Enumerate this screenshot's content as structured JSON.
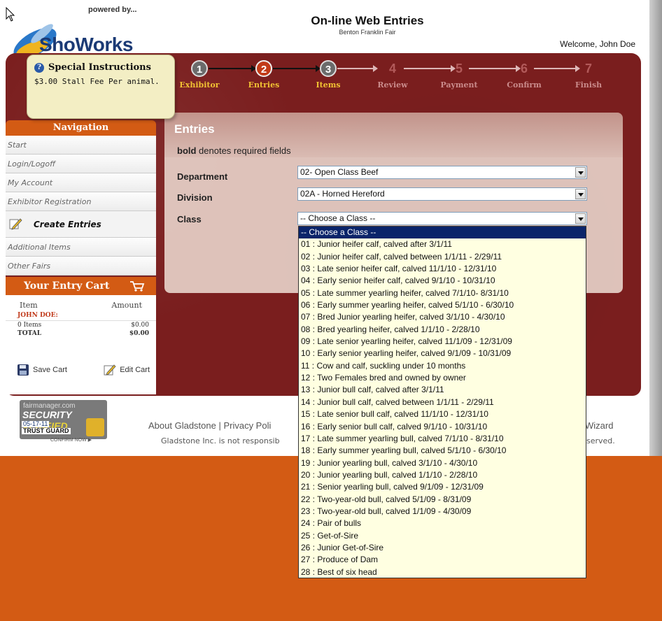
{
  "header": {
    "powered_by": "powered by...",
    "brand": "ShoWorks",
    "title": "On-line Web Entries",
    "subtitle": "Benton Franklin Fair",
    "welcome": "Welcome, John Doe"
  },
  "steps": [
    {
      "num": "1",
      "label": "Exhibitor",
      "state": "done"
    },
    {
      "num": "2",
      "label": "Entries",
      "state": "current"
    },
    {
      "num": "3",
      "label": "Items",
      "state": "done"
    },
    {
      "num": "4",
      "label": "Review",
      "state": "future"
    },
    {
      "num": "5",
      "label": "Payment",
      "state": "future"
    },
    {
      "num": "6",
      "label": "Confirm",
      "state": "future"
    },
    {
      "num": "7",
      "label": "Finish",
      "state": "future"
    }
  ],
  "tooltip": {
    "title": "Special Instructions",
    "body": "$3.00 Stall Fee Per animal."
  },
  "navigation": {
    "title": "Navigation",
    "items": [
      "Start",
      "Login/Logoff",
      "My Account",
      "Exhibitor Registration",
      "Create Entries",
      "Additional Items",
      "Other Fairs"
    ]
  },
  "cart": {
    "title": "Your Entry Cart",
    "col_item": "Item",
    "col_amount": "Amount",
    "owner": "JOHN DOE:",
    "items_label": "0 Items",
    "items_amount": "$0.00",
    "total_label": "TOTAL",
    "total_amount": "$0.00",
    "save": "Save Cart",
    "edit": "Edit Cart"
  },
  "entries": {
    "title": "Entries",
    "note_bold": "bold",
    "note_rest": " denotes required fields",
    "department_label": "Department",
    "department_value": "02- Open Class Beef",
    "division_label": "Division",
    "division_value": "02A - Horned Hereford",
    "class_label": "Class",
    "class_value": "-- Choose a Class --"
  },
  "class_options": [
    "-- Choose a Class --",
    "01 : Junior heifer calf, calved after 3/1/11",
    "02 : Junior heifer calf, calved between 1/1/11 - 2/29/11",
    "03 : Late senior heifer calf, calved 11/1/10 - 12/31/10",
    "04 : Early senior heifer calf, calved 9/1/10 - 10/31/10",
    "05 : Late summer yearling heifer, calved 7/1/10- 8/31/10",
    "06 : Early summer yearling heifer, calved 5/1/10 - 6/30/10",
    "07 : Bred Junior yearling heifer, calved 3/1/10 - 4/30/10",
    "08 : Bred yearling heifer, calved 1/1/10 - 2/28/10",
    "09 : Late senior yearling heifer, calved 11/1/09 - 12/31/09",
    "10 : Early senior yearling heifer, calved 9/1/09 - 10/31/09",
    "11 : Cow and calf, suckling under 10 months",
    "12 : Two Females bred and owned by owner",
    "13 : Junior bull calf, calved after 3/1/11",
    "14 : Junior bull calf, calved between 1/1/11 - 2/29/11",
    "15 : Late senior bull calf, calved 11/1/10 - 12/31/10",
    "16 : Early senior bull calf, calved 9/1/10 - 10/31/10",
    "17 : Late summer yearling bull, calved 7/1/10 - 8/31/10",
    "18 : Early summer yearling bull, calved 5/1/10 - 6/30/10",
    "19 : Junior yearling bull, calved 3/1/10 - 4/30/10",
    "20 : Junior yearling bull, calved 1/1/10 - 2/28/10",
    "21 : Senior yearling bull, calved 9/1/09 - 12/31/09",
    "22 : Two-year-old bull, calved 5/1/09 - 8/31/09",
    "23 : Two-year-old bull, calved 1/1/09 - 4/30/09",
    "24 : Pair of bulls",
    "25 : Get-of-Sire",
    "26 : Junior Get-of-Sire",
    "27 : Produce of Dam",
    "28 : Best of six head"
  ],
  "footer": {
    "seal_top": "fairmanager.com",
    "seal_security": "SECURITY",
    "seal_verified": "VERIFIED",
    "seal_date": "05-17-11",
    "seal_guard": "TRUST GUARD",
    "seal_confirm": "CONFIRM NOW ▶",
    "links": "About Gladstone | Privacy Poli",
    "note": "Gladstone Inc. is not responsib",
    "right_link": "Wizard",
    "right_note": "served."
  },
  "colors": {
    "orange": "#d35b14",
    "maroon": "#7a1e1e",
    "step_active": "#f1c233",
    "dropdown_bg": "#ffffe1",
    "dropdown_selected": "#0a246a"
  }
}
